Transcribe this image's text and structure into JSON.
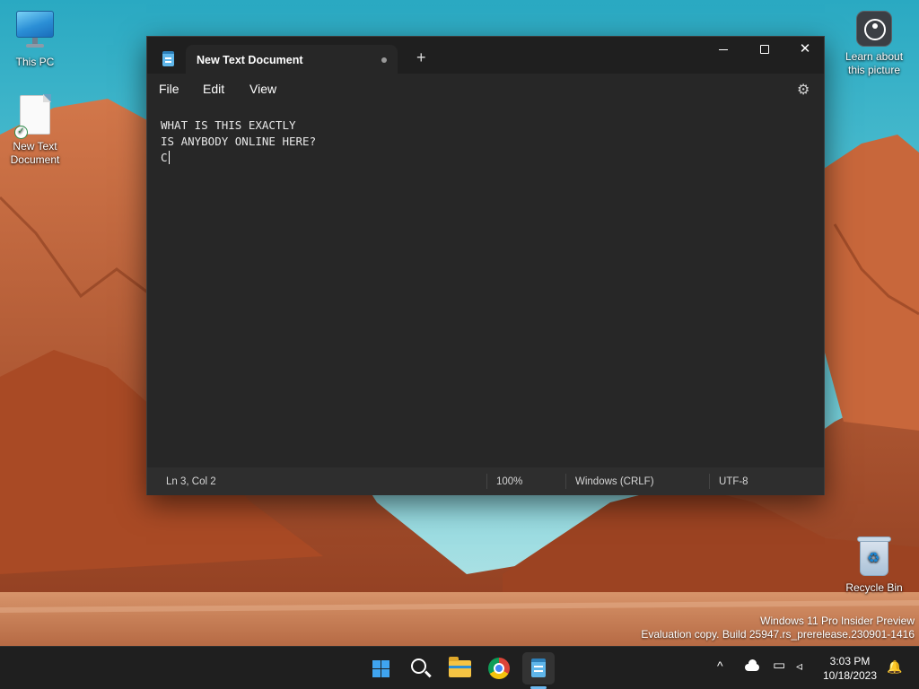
{
  "desktop": {
    "icons": [
      {
        "label": "This PC",
        "icon": "monitor-icon"
      },
      {
        "label": "New Text\nDocument",
        "icon": "text-document-icon"
      },
      {
        "label": "Learn about\nthis picture",
        "icon": "camera-spotlight-icon"
      },
      {
        "label": "Recycle Bin",
        "icon": "recycle-bin-icon"
      }
    ],
    "watermark": {
      "line1": "Windows 11 Pro Insider Preview",
      "line2": "Evaluation copy. Build 25947.rs_prerelease.230901-1416"
    }
  },
  "window": {
    "tab_title": "New Text Document",
    "new_tab_symbol": "+",
    "close_symbol": "✕",
    "menu": {
      "file": "File",
      "edit": "Edit",
      "view": "View"
    },
    "content_lines": [
      "WHAT IS THIS EXACTLY",
      "IS ANYBODY ONLINE HERE?",
      "C"
    ],
    "status": {
      "position": "Ln 3, Col 2",
      "zoom": "100%",
      "line_ending": "Windows (CRLF)",
      "encoding": "UTF-8"
    }
  },
  "taskbar": {
    "apps": [
      "start-icon",
      "search-icon",
      "file-explorer-icon",
      "chrome-icon",
      "notepad-icon"
    ],
    "active_app": "notepad-icon",
    "tray": {
      "time": "3:03 PM",
      "date": "10/18/2023",
      "chevron": "^"
    }
  },
  "colors": {
    "window_bg": "#272727",
    "titlebar_bg": "#1f1f1f",
    "accent": "#6cb8ee",
    "sky": "#3fb6c6",
    "rock": "#c4643a"
  }
}
